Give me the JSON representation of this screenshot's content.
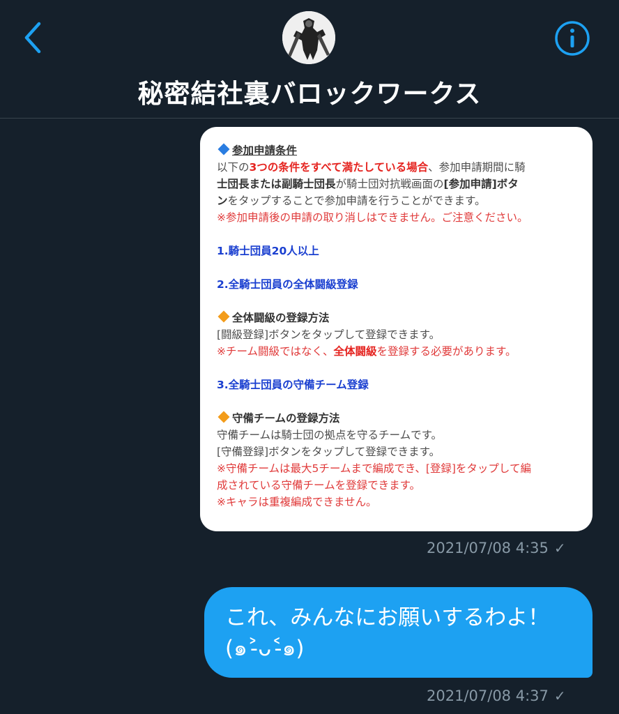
{
  "header": {
    "title": "秘密結社裏バロックワークス",
    "back_icon": "chevron-left-icon",
    "info_icon": "info-icon",
    "accent_color": "#1da1f2"
  },
  "messages": [
    {
      "type": "image",
      "content": {
        "heading": "参加申請条件",
        "line1_a": "以下の",
        "line1_b": "3つの条件をすべて満たしている場合",
        "line1_c": "、参加申請期間に騎",
        "line2_a": "士団長または副騎士団長",
        "line2_b": "が騎士団対抗戦画面の",
        "line2_c": "[参加申請]ボタ",
        "line3_a": "ン",
        "line3_b": "をタップすることで参加申請を行うことができます。",
        "line4": "※参加申請後の申請の取り消しはできません。ご注意ください。",
        "cond1": "1.騎士団員20人以上",
        "cond2": "2.全騎士団員の全体闘級登録",
        "sub1_heading": "全体闘級の登録方法",
        "sub1_line1": "[闘級登録]ボタンをタップして登録できます。",
        "sub1_line2_a": "※チーム闘級ではなく、",
        "sub1_line2_b": "全体闘級",
        "sub1_line2_c": "を登録する必要があります。",
        "cond3": "3.全騎士団員の守備チーム登録",
        "sub2_heading": "守備チームの登録方法",
        "sub2_line1": "守備チームは騎士団の拠点を守るチームです。",
        "sub2_line2": "[守備登録]ボタンをタップして登録できます。",
        "sub2_line3": "※守備チームは最大5チームまで編成でき、[登録]をタップして編",
        "sub2_line4": "成されている守備チームを登録できます。",
        "sub2_line5": "※キャラは重複編成できません。"
      },
      "timestamp": "2021/07/08 4:35",
      "status_icon": "check-icon"
    },
    {
      "type": "text",
      "line1": "これ、みんなにお願いするわよ！",
      "line2": "(๑˃̵ᴗ˂̵๑)",
      "timestamp": "2021/07/08 4:37",
      "status_icon": "check-icon"
    }
  ]
}
